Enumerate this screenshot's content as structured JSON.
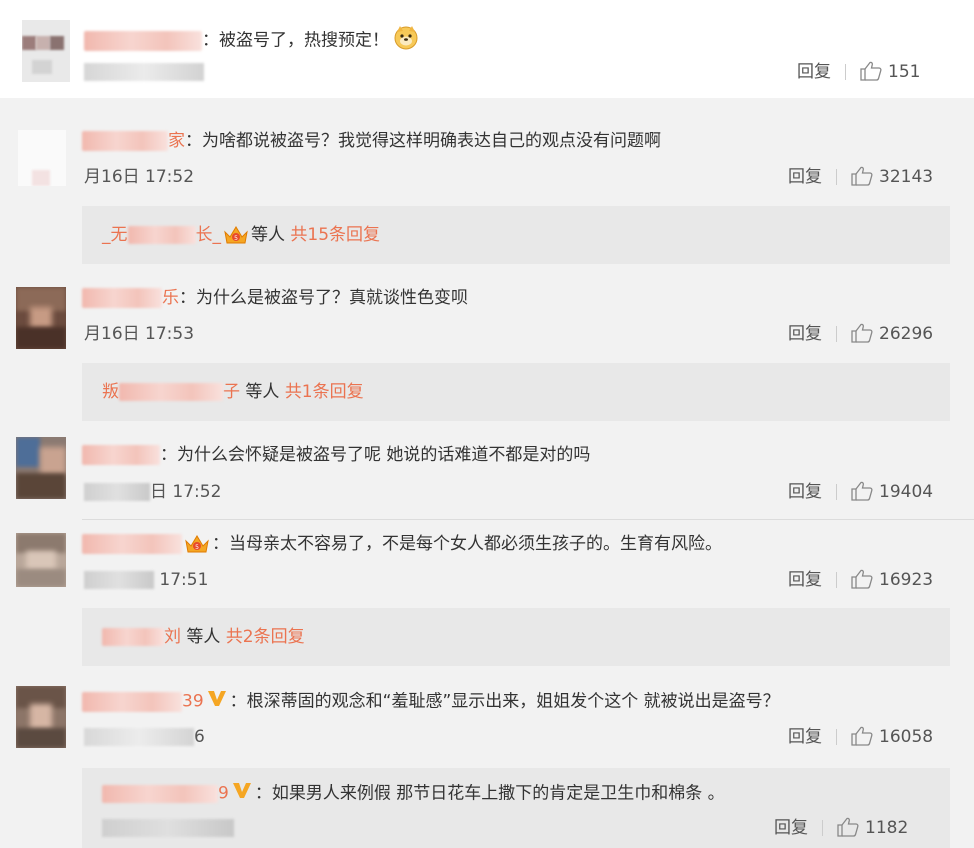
{
  "comments": [
    {
      "name_tail": "",
      "text": "被盗号了，热搜预定！",
      "time": "",
      "reply": "回复",
      "likes": "151"
    },
    {
      "name_tail": "家",
      "text": "为啥都说被盗号？我觉得这样明确表达自己的观点没有问题啊",
      "time": "月16日 17:52",
      "reply": "回复",
      "likes": "32143",
      "sub": {
        "name_head": "_无",
        "name_tail": "长_",
        "etc": "等人",
        "count": "共15条回复"
      }
    },
    {
      "name_tail": "乐",
      "text": "为什么是被盗号了？真就谈性色变呗",
      "time": "月16日 17:53",
      "reply": "回复",
      "likes": "26296",
      "sub": {
        "name_head": "叛",
        "name_tail": "子",
        "etc": "等人",
        "count": "共1条回复"
      }
    },
    {
      "name_tail": "",
      "text": "为什么会怀疑是被盗号了呢 她说的话难道不都是对的吗",
      "time": "日 17:52",
      "reply": "回复",
      "likes": "19404"
    },
    {
      "name_tail": "",
      "text": "当母亲太不容易了，不是每个女人都必须生孩子的。生育有风险。",
      "time": "17:51",
      "reply": "回复",
      "likes": "16923",
      "sub": {
        "name_head": "",
        "name_tail": "刘",
        "etc": "等人",
        "count": "共2条回复"
      }
    },
    {
      "name_tail": "39",
      "text": "根深蒂固的观念和“羞耻感”显示出来，姐姐发个这个 就被说出是盗号？",
      "time": "6",
      "reply": "回复",
      "likes": "16058"
    },
    {
      "name_tail": "9",
      "text": "如果男人来例假 那节日花车上撒下的肯定是卫生巾和棉条 。",
      "time": "",
      "reply": "回复",
      "likes": "1182"
    }
  ],
  "colors": {
    "accent": "#eb7350",
    "gold": "#f5a623"
  }
}
